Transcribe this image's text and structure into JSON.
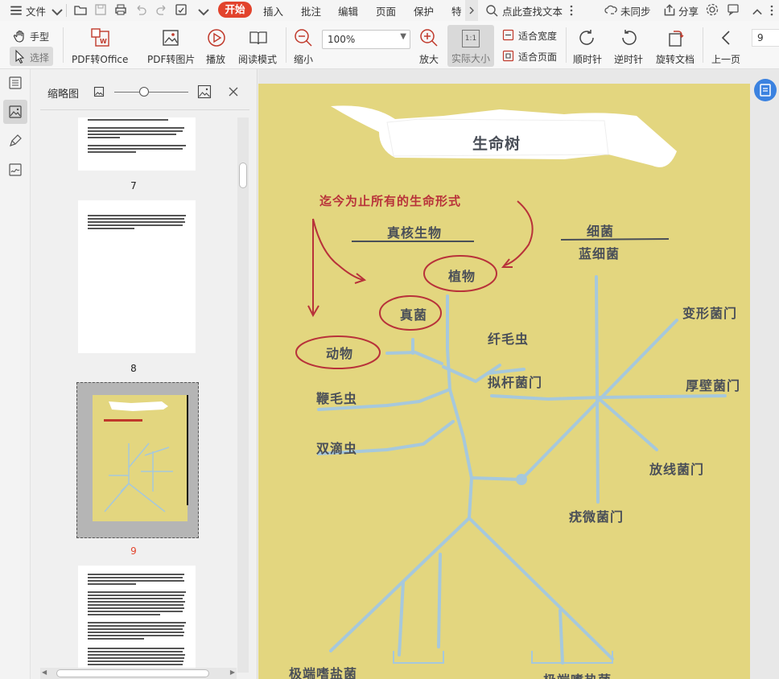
{
  "menubar": {
    "file": "文件",
    "start": "开始",
    "insert": "插入",
    "annotate": "批注",
    "edit": "编辑",
    "page": "页面",
    "protect": "保护",
    "special": "特",
    "search_placeholder": "点此查找文本",
    "sync": "未同步",
    "share": "分享"
  },
  "toolbar": {
    "hand": "手型",
    "select": "选择",
    "pdf_to_office": "PDF转Office",
    "pdf_to_image": "PDF转图片",
    "play": "播放",
    "read_mode": "阅读模式",
    "zoom_out": "缩小",
    "zoom_value": "100%",
    "zoom_in": "放大",
    "actual_size": "实际大小",
    "actual_size_icon": "1:1",
    "fit_width": "适合宽度",
    "fit_page": "适合页面",
    "rotate_cw": "顺时针",
    "rotate_ccw": "逆时针",
    "rotate_doc": "旋转文档",
    "prev_page": "上一页",
    "page_input": "9"
  },
  "thumbnails": {
    "title": "缩略图",
    "zoom_level": 0.4,
    "pages": [
      {
        "number": "7",
        "current": false
      },
      {
        "number": "8",
        "current": false
      },
      {
        "number": "9",
        "current": true
      }
    ]
  },
  "document": {
    "title": "生命树",
    "red_heading": "迄今为止所有的生命形式",
    "eukaryote": "真核生物",
    "bacteria": "细菌",
    "cyanobacteria": "蓝细菌",
    "plants": "植物",
    "fungi": "真菌",
    "animals": "动物",
    "ciliates": "纤毛虫",
    "flagellates": "鞭毛虫",
    "diplomonads": "双滴虫",
    "pseudomonad_phylum": "拟杆菌门",
    "proteobacteria": "变形菌门",
    "firmicutes": "厚壁菌门",
    "actinobacteria": "放线菌门",
    "tenericutes": "疣微菌门",
    "halophiles": "极端嗜盐菌",
    "thermophiles": "极端嗜热菌"
  },
  "colors": {
    "accent_red": "#e2432c",
    "page_bg": "#e3d67f",
    "tree_blue": "#a6c8dc",
    "ink_red": "#b8323a",
    "ink_dark": "#4a4f58"
  }
}
